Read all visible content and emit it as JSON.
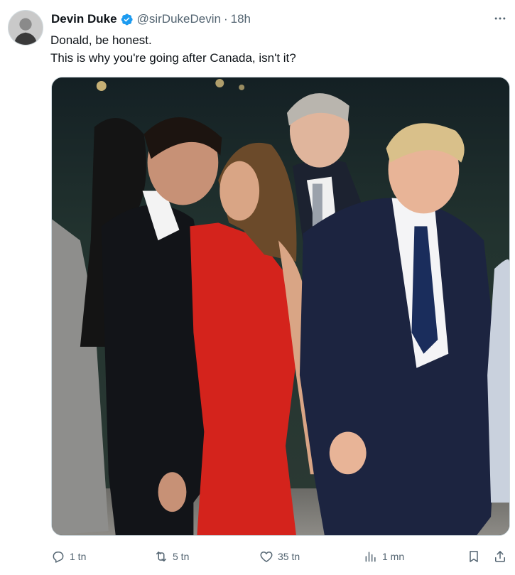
{
  "author": {
    "name": "Devin Duke",
    "handle": "@sirDukeDevin",
    "separator": "·",
    "time": "18h",
    "verified": true
  },
  "tweet": {
    "lines": [
      "Donald, be honest.",
      "This is why you're going after Canada, isn't it?"
    ]
  },
  "actions": {
    "reply": {
      "icon": "reply-icon",
      "count": "1 tn"
    },
    "retweet": {
      "icon": "retweet-icon",
      "count": "5 tn"
    },
    "like": {
      "icon": "heart-icon",
      "count": "35 tn"
    },
    "views": {
      "icon": "views-icon",
      "count": "1 mn"
    },
    "bookmark": {
      "icon": "bookmark-icon"
    },
    "share": {
      "icon": "share-icon"
    }
  },
  "colors": {
    "text": "#0f1419",
    "secondary": "#536471",
    "verified": "#1d9bf0",
    "border": "#cfd9de"
  }
}
